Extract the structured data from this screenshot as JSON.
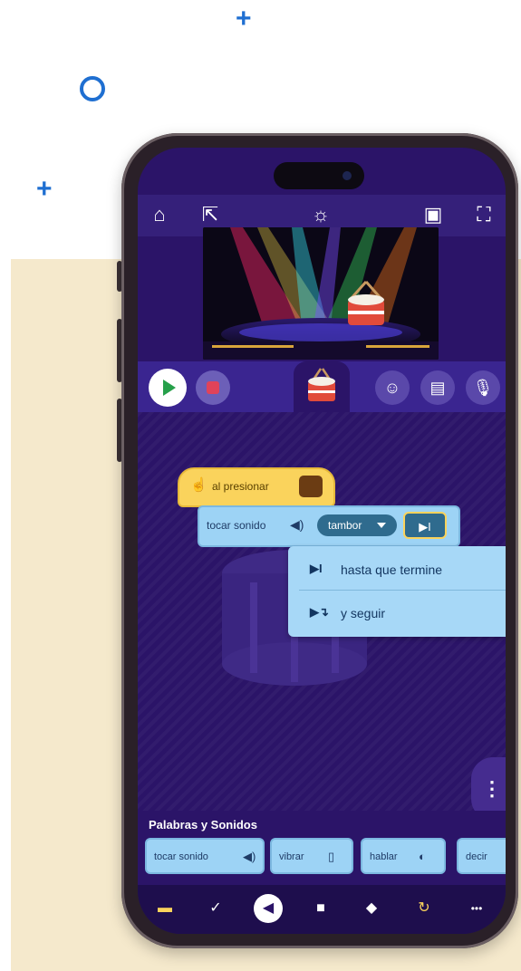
{
  "decorations": {
    "plus_glyph": "+",
    "accent": "#1f6fd1"
  },
  "topbar": {
    "icons": [
      "home-icon",
      "share-icon",
      "brightness-icon",
      "device-icon",
      "fullscreen-icon"
    ],
    "home": "⌂",
    "share": "⇱",
    "brightness": "☼",
    "device": "▣",
    "fullscreen": "⛶"
  },
  "controls": {
    "emoji_btn": "☺",
    "image_btn": "▤",
    "mic_btn": "🎙"
  },
  "script": {
    "hat_label": "al presionar",
    "sound_label": "tocar sonido",
    "sound_dropdown": "tambor",
    "mode_symbol": "▶I"
  },
  "menu": {
    "items": [
      {
        "icon": "▶I",
        "label": "hasta que termine"
      },
      {
        "icon": "▶↴",
        "label": "y seguir"
      }
    ]
  },
  "fab_glyph": "⋮",
  "palette": {
    "title": "Palabras y Sonidos",
    "blocks": [
      {
        "label": "tocar sonido",
        "icon": "◀)"
      },
      {
        "label": "vibrar",
        "icon": "▯"
      },
      {
        "label": "hablar",
        "icon": "◐"
      },
      {
        "label": "decir",
        "icon": ""
      }
    ]
  },
  "categories": [
    {
      "name": "events",
      "glyph": "▬",
      "color": "#fad35c"
    },
    {
      "name": "motion",
      "glyph": "✓",
      "color": "#ffffff"
    },
    {
      "name": "sound",
      "glyph": "◀",
      "color": "#2b1468"
    },
    {
      "name": "looks",
      "glyph": "■",
      "color": "#ffffff"
    },
    {
      "name": "paint",
      "glyph": "◆",
      "color": "#ffffff"
    },
    {
      "name": "control",
      "glyph": "↻",
      "color": "#fad35c"
    },
    {
      "name": "more",
      "glyph": "•••",
      "color": "#ffffff"
    }
  ]
}
